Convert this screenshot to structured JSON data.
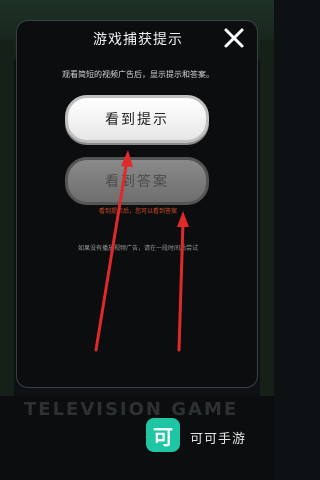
{
  "background": {
    "strip_text": "TELEVISION GAME"
  },
  "modal": {
    "title": "游戏捕获提示",
    "description": "观看简短的视频广告后，显示提示和答案。",
    "hint_button": "看到提示",
    "answer_button": "看到答案",
    "answer_hint": "看到提示后，您可以看到答案",
    "note": "如果没有播放视频广告，请在一段时间后尝试",
    "close_icon": "close-icon"
  },
  "watermark": {
    "logo_char": "可",
    "text": "可可手游"
  },
  "colors": {
    "modal_bg": "#0b0d0f",
    "accent_red": "#d84a2a",
    "watermark": "#1ec6a4"
  }
}
